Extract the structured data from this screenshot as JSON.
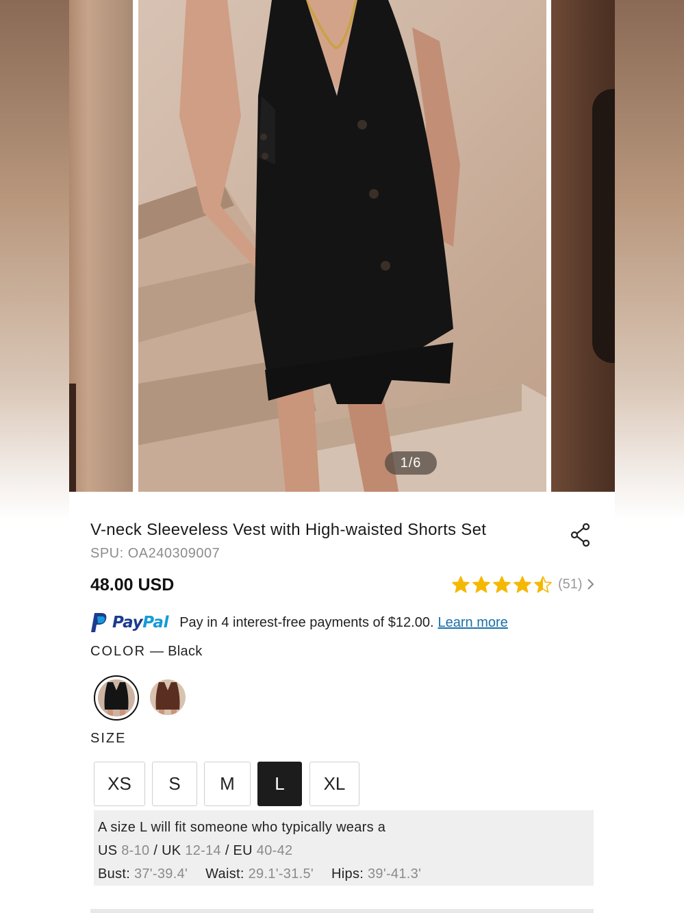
{
  "gallery": {
    "counter": "1/6",
    "current": 1,
    "total": 6
  },
  "product": {
    "title": "V-neck Sleeveless Vest with High-waisted Shorts Set",
    "spu": "SPU: OA240309007",
    "price": "48.00 USD",
    "rating": {
      "stars": 4.5,
      "count": "(51)",
      "star_color": "#f5b800"
    }
  },
  "paypal": {
    "logo_pay": "Pay",
    "logo_pal": "Pal",
    "message": "Pay in 4 interest-free payments of $12.00.",
    "link": "Learn more"
  },
  "color": {
    "label": "COLOR",
    "dash": " — ",
    "selected": "Black",
    "swatches": [
      {
        "name": "Black",
        "selected": true
      },
      {
        "name": "Brown",
        "selected": false
      }
    ]
  },
  "size": {
    "label": "SIZE",
    "options": [
      "XS",
      "S",
      "M",
      "L",
      "XL"
    ],
    "selected": "L"
  },
  "fit": {
    "line1": "A size L will fit someone who typically wears a",
    "us_label": "US",
    "us_val": "8-10",
    "uk_label": "UK",
    "uk_val": "12-14",
    "eu_label": "EU",
    "eu_val": "40-42",
    "sep": " / ",
    "bust_label": "Bust:",
    "bust_val": "37'-39.4'",
    "waist_label": "Waist:",
    "waist_val": "29.1'-31.5'",
    "hips_label": "Hips:",
    "hips_val": "39'-41.3'"
  }
}
